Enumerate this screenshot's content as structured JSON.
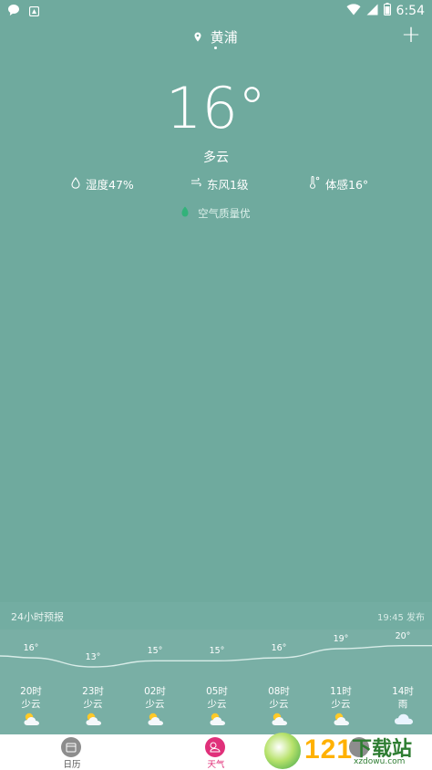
{
  "status": {
    "time": "6:54",
    "left_icons": [
      "chat-bubble-icon",
      "notification-icon"
    ],
    "right_icons": [
      "wifi-icon",
      "cell-signal-icon",
      "battery-icon"
    ]
  },
  "header": {
    "city": "黄浦",
    "add_label": "+"
  },
  "current": {
    "temp": "16°",
    "condition": "多云",
    "humidity": "湿度47%",
    "wind": "东风1级",
    "feels": "体感16°",
    "air_quality": "空气质量优"
  },
  "forecast": {
    "title": "24小时预报",
    "published": "19:45 发布",
    "chart_data": {
      "type": "line",
      "categories": [
        "20时",
        "23时",
        "02时",
        "05时",
        "08时",
        "11时",
        "14时"
      ],
      "conditions": [
        "少云",
        "少云",
        "少云",
        "少云",
        "少云",
        "少云",
        "雨"
      ],
      "temps": [
        16,
        13,
        15,
        15,
        16,
        19,
        20
      ],
      "temp_labels": [
        "16°",
        "13°",
        "15°",
        "15°",
        "16°",
        "19°",
        "20°"
      ]
    }
  },
  "tabs": [
    {
      "label": "日历",
      "icon": "calendar-icon",
      "active": false
    },
    {
      "label": "天气",
      "icon": "weather-icon",
      "active": true
    },
    {
      "label": "",
      "icon": "more-icon",
      "active": false
    }
  ],
  "watermark": {
    "brand_num": "121",
    "brand_text": "下载站",
    "url": "xzdowu.com"
  },
  "colors": {
    "background": "#6faa9e",
    "active_tab": "#e0307a",
    "leaf": "#33b27a"
  }
}
